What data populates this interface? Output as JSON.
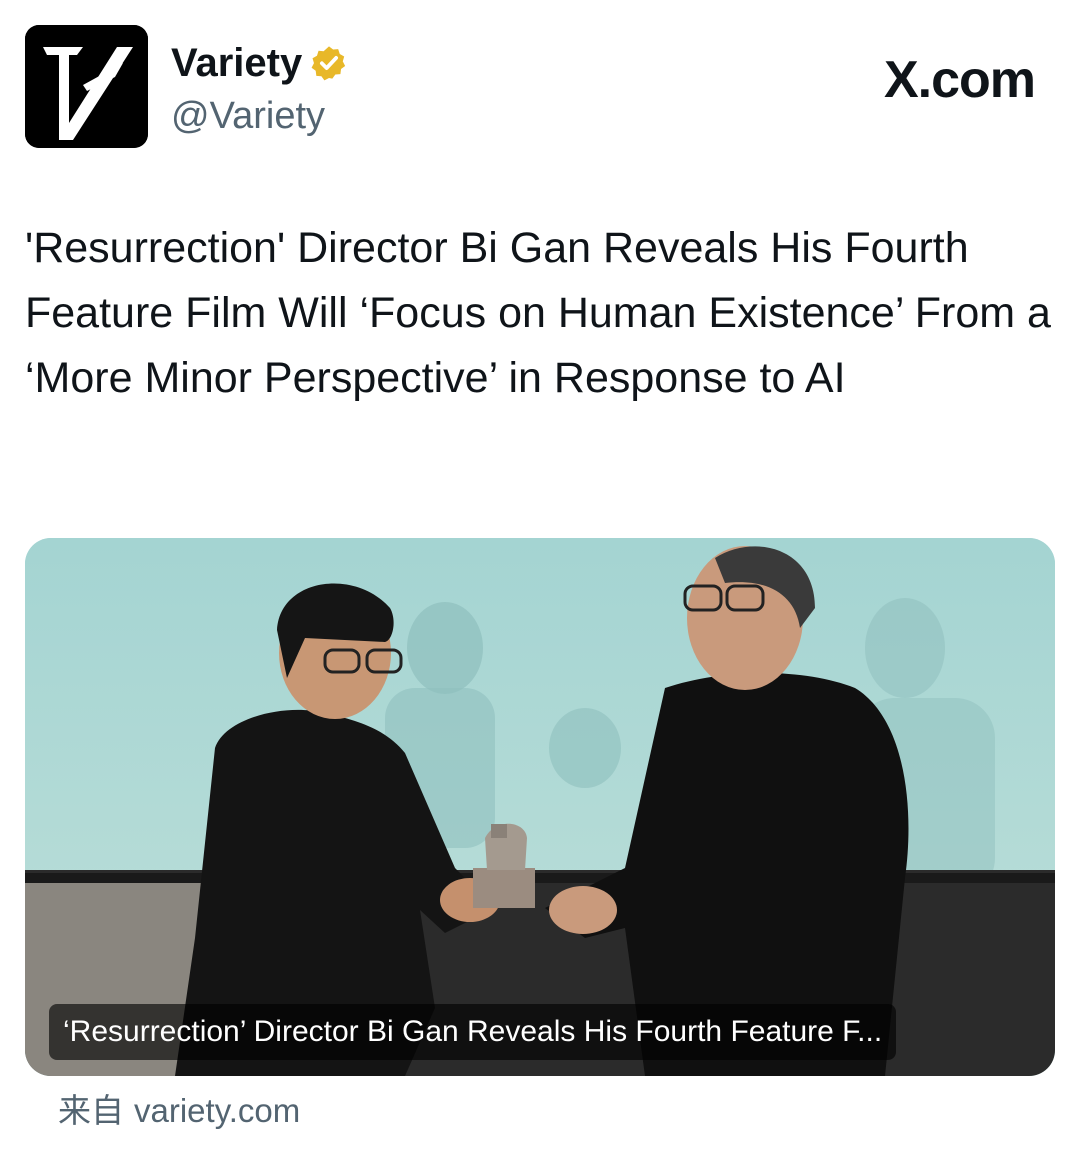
{
  "header": {
    "display_name": "Variety",
    "handle": "@Variety",
    "site_brand": "X.com",
    "avatar_icon": "variety-v-logo-icon",
    "verified_icon": "verified-gold-badge-icon",
    "badge_color": "#e8b829"
  },
  "tweet": {
    "text": "'Resurrection' Director Bi Gan Reveals His Fourth Feature Film Will ‘Focus on Human Existence’ From a ‘More Minor Perspective’ in Response to AI"
  },
  "card": {
    "title": "‘Resurrection’ Director Bi Gan Reveals His Fourth Feature F...",
    "image_icon": "award-ceremony-photo"
  },
  "source": {
    "prefix": "来自",
    "domain": "variety.com"
  }
}
